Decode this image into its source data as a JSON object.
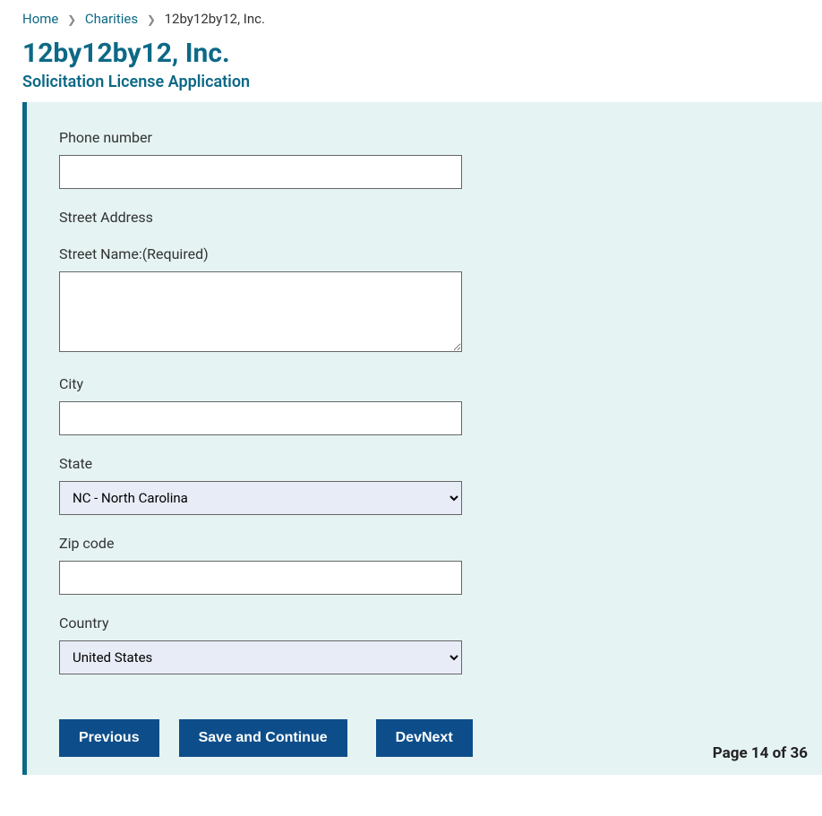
{
  "breadcrumb": {
    "home": "Home",
    "charities": "Charities",
    "current": "12by12by12, Inc."
  },
  "header": {
    "title": "12by12by12, Inc.",
    "subtitle": "Solicitation License Application"
  },
  "form": {
    "phone": {
      "label": "Phone number",
      "value": ""
    },
    "street_section": "Street Address",
    "street": {
      "label": "Street Name:",
      "required": "(Required)",
      "value": ""
    },
    "city": {
      "label": "City",
      "value": ""
    },
    "state": {
      "label": "State",
      "selected": "NC - North Carolina"
    },
    "zip": {
      "label": "Zip code",
      "value": ""
    },
    "country": {
      "label": "Country",
      "selected": "United States"
    }
  },
  "buttons": {
    "previous": "Previous",
    "save_continue": "Save and Continue",
    "devnext": "DevNext"
  },
  "page_indicator": "Page 14 of 36"
}
